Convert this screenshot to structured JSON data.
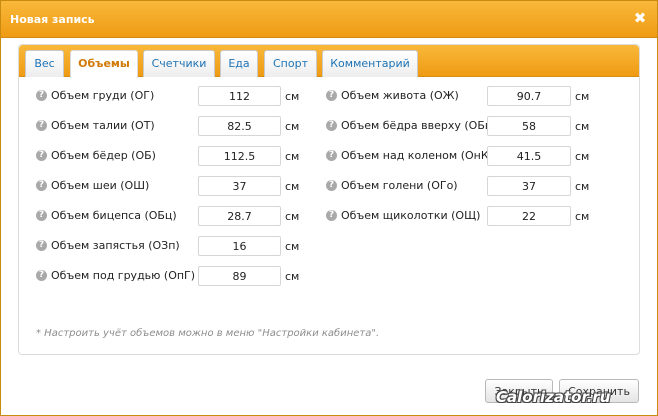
{
  "dialog": {
    "title": "Новая запись",
    "close_glyph": "✖"
  },
  "tabs": [
    {
      "label": "Вес",
      "active": false
    },
    {
      "label": "Объемы",
      "active": true
    },
    {
      "label": "Счетчики",
      "active": false
    },
    {
      "label": "Еда",
      "active": false
    },
    {
      "label": "Спорт",
      "active": false
    },
    {
      "label": "Комментарий",
      "active": false
    }
  ],
  "help_glyph": "?",
  "unit": "см",
  "left_fields": [
    {
      "label": "Объем груди (ОГ)",
      "value": "112"
    },
    {
      "label": "Объем талии (ОТ)",
      "value": "82.5"
    },
    {
      "label": "Объем бёдер (ОБ)",
      "value": "112.5"
    },
    {
      "label": "Объем шеи (ОШ)",
      "value": "37"
    },
    {
      "label": "Объем бицепса (ОБц)",
      "value": "28.7"
    },
    {
      "label": "Объем запястья (ОЗп)",
      "value": "16"
    },
    {
      "label": "Объем под грудью (ОпГ)",
      "value": "89"
    }
  ],
  "right_fields": [
    {
      "label": "Объем живота (ОЖ)",
      "value": "90.7"
    },
    {
      "label": "Объем бёдра вверху (ОБв)",
      "value": "58"
    },
    {
      "label": "Объем над коленом (ОнК)",
      "value": "41.5"
    },
    {
      "label": "Объем голени (ОГо)",
      "value": "37"
    },
    {
      "label": "Объем щиколотки (ОЩ)",
      "value": "22"
    }
  ],
  "note": "* Настроить учёт объемов можно в меню \"Настройки кабинета\".",
  "buttons": {
    "close_label": "Закрыть",
    "save_label": "Сохранить"
  },
  "watermark": "Calorizator.ru",
  "colors": {
    "accent": "#f0a020",
    "tab_active_text": "#d17a08",
    "tab_text": "#1e73b5"
  }
}
